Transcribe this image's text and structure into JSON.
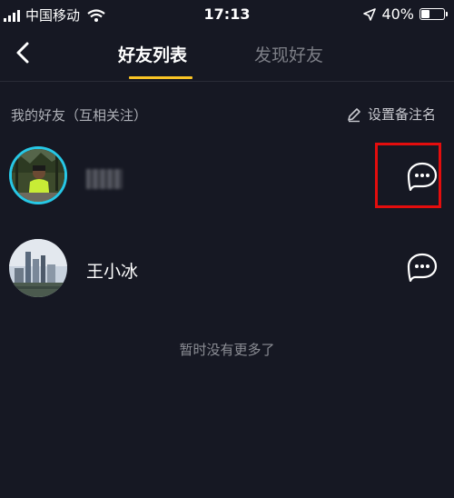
{
  "status_bar": {
    "carrier": "中国移动",
    "time": "17:13",
    "battery_percent": "40%",
    "battery_level": 0.4
  },
  "nav": {
    "back_icon": "chevron-left-icon",
    "tabs": [
      {
        "label": "好友列表",
        "active": true
      },
      {
        "label": "发现好友",
        "active": false
      }
    ],
    "accent_color": "#fac425"
  },
  "section": {
    "title": "我的好友（互相关注）",
    "edit_remark_label": "设置备注名",
    "edit_icon": "pencil-icon"
  },
  "friends": [
    {
      "name": "",
      "name_obscured": true,
      "chat_icon": "chat-bubble-icon"
    },
    {
      "name": "王小冰",
      "chat_icon": "chat-bubble-icon"
    }
  ],
  "footer": {
    "no_more_text": "暂时没有更多了"
  },
  "colors": {
    "background": "#161823",
    "highlight": "#e40d0d",
    "avatar_ring": "#27c8e6"
  }
}
